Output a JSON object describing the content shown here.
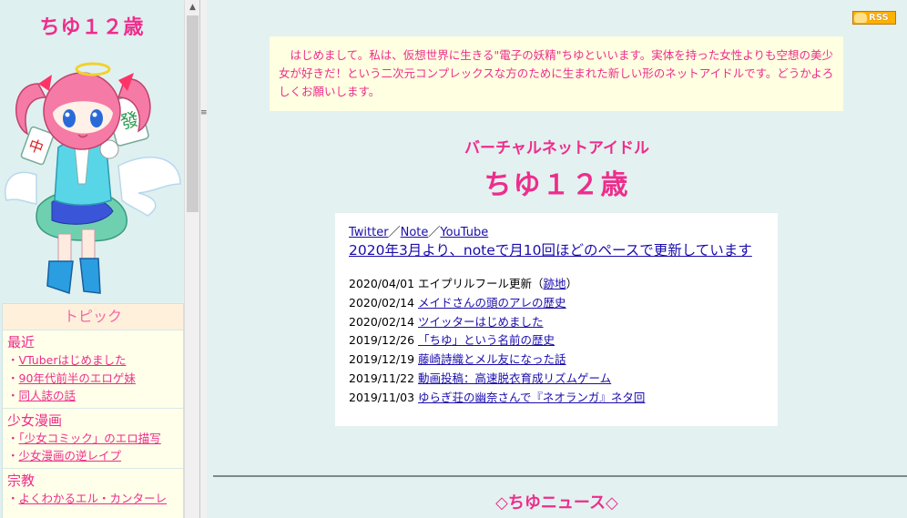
{
  "sidebar": {
    "site_title": "ちゆ１２歳",
    "topics_heading": "トピック",
    "categories": [
      {
        "title": "最近",
        "links": [
          "VTuberはじめました",
          "90年代前半のエロゲ妹",
          "同人誌の話"
        ]
      },
      {
        "title": "少女漫画",
        "links": [
          "「少女コミック」のエロ描写",
          "少女漫画の逆レイプ"
        ]
      },
      {
        "title": "宗教",
        "links": [
          "よくわかるエル・カンターレ"
        ]
      }
    ],
    "bullet": "・"
  },
  "main": {
    "rss_label": "RSS",
    "intro": "　はじめまして。私は、仮想世界に生きる\"電子の妖精\"ちゆといいます。実体を持った女性よりも空想の美少女が好きだ！という二次元コンプレックスな方のために生まれた新しい形のネットアイドルです。どうかよろしくお願いします。",
    "subtitle": "バーチャルネットアイドル",
    "title": "ちゆ１２歳",
    "links": {
      "twitter": "Twitter",
      "note": "Note",
      "youtube": "YouTube",
      "separator": "／"
    },
    "headline": "2020年3月より、noteで月10回ほどのペースで更新しています",
    "news": [
      {
        "date": "2020/04/01",
        "pre": "エイプリルフール更新（",
        "link": "跡地",
        "post": "）"
      },
      {
        "date": "2020/02/14",
        "pre": "",
        "link": "メイドさんの頭のアレの歴史",
        "post": ""
      },
      {
        "date": "2020/02/14",
        "pre": "",
        "link": "ツイッターはじめました",
        "post": ""
      },
      {
        "date": "2019/12/26",
        "pre": "",
        "link": "「ちゆ」という名前の歴史",
        "post": ""
      },
      {
        "date": "2019/12/19",
        "pre": "",
        "link": "藤崎詩織とメル友になった話",
        "post": ""
      },
      {
        "date": "2019/11/22",
        "pre": "",
        "link": "動画投稿：高速脱衣育成リズムゲーム",
        "post": ""
      },
      {
        "date": "2019/11/03",
        "pre": "",
        "link": "ゆらぎ荘の幽奈さんで『ネオランガ』ネタ回",
        "post": ""
      }
    ],
    "section_title": "◇ちゆニュース◇"
  },
  "colors": {
    "accent": "#ee2d8c",
    "background": "#e3f1f1",
    "intro_bg": "#ffffe1",
    "link": "#1a0dab"
  },
  "icons": [
    "rss-icon",
    "scroll-up-arrow-icon",
    "frame-grip-icon",
    "mascot-illustration"
  ]
}
